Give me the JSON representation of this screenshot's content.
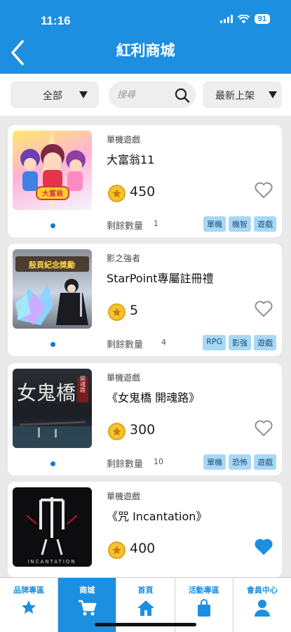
{
  "status_bar": {
    "time": "11:16",
    "battery": "91"
  },
  "header": {
    "title": "紅利商城"
  },
  "filters": {
    "category": "全部",
    "search_placeholder": "搜尋",
    "sort": "最新上架"
  },
  "stock_label": "剩餘數量",
  "products": [
    {
      "category": "單機遊戲",
      "title": "大富翁11",
      "price": "450",
      "stock": "1",
      "tags": [
        "單機",
        "機智",
        "遊戲"
      ],
      "favorited": false
    },
    {
      "category": "影之強者",
      "title": "StarPoint專屬註冊禮",
      "price": "5",
      "stock": "4",
      "tags": [
        "RPG",
        "影強",
        "遊戲"
      ],
      "favorited": false
    },
    {
      "category": "單機遊戲",
      "title": "《女鬼橋 開魂路》",
      "price": "300",
      "stock": "10",
      "tags": [
        "單機",
        "恐怖",
        "遊戲"
      ],
      "favorited": false
    },
    {
      "category": "單機遊戲",
      "title": "《咒 Incantation》",
      "price": "400",
      "stock": "",
      "tags": [],
      "favorited": true
    }
  ],
  "thumb_text": {
    "p1_logo": "大富翁",
    "p2_banner": "殷頁紀念獎勵",
    "p3_title": "女鬼橋",
    "p3_sub": "開魂路",
    "p4_title": "INCANTATION"
  },
  "tabs": [
    {
      "label": "品牌專區",
      "icon": "star-icon"
    },
    {
      "label": "商城",
      "icon": "cart-icon"
    },
    {
      "label": "首頁",
      "icon": "home-icon"
    },
    {
      "label": "活動專區",
      "icon": "bag-icon"
    },
    {
      "label": "會員中心",
      "icon": "user-icon"
    }
  ],
  "active_tab": "商城",
  "colors": {
    "primary": "#1d8fe0",
    "tag_bg": "#a9d8f6",
    "coin": "#f3c431",
    "heart_filled": "#1d8fe0",
    "background": "#e9e9e9"
  }
}
